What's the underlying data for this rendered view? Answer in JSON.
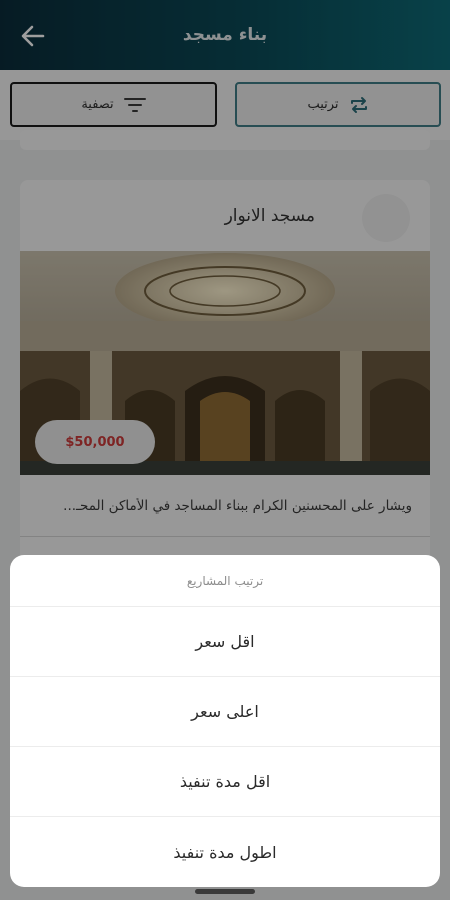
{
  "appbar": {
    "title": "بناء مسجد",
    "back_icon": "arrow-left-icon"
  },
  "toolbar": {
    "sort_label": "ترتيب",
    "sort_icon": "repeat-arrows-icon",
    "filter_label": "تصفية",
    "filter_icon": "filter-lines-icon"
  },
  "project_card": {
    "title": "مسجد الانوار",
    "price": "$50,000",
    "description": "ويشار على المحسنين الكرام ببناء المساجد في الأماكن المحـ..."
  },
  "sort_sheet": {
    "title": "ترتيب المشاريع",
    "options": [
      {
        "label": "اقل سعر"
      },
      {
        "label": "اعلى سعر"
      },
      {
        "label": "اقل مدة تنفيذ"
      },
      {
        "label": "اطول مدة تنفيذ"
      }
    ]
  },
  "colors": {
    "appbar_start": "#0a2d3b",
    "appbar_end": "#0d6a76",
    "sort_border": "#3f7c86",
    "price_text": "#cc3a3a"
  }
}
